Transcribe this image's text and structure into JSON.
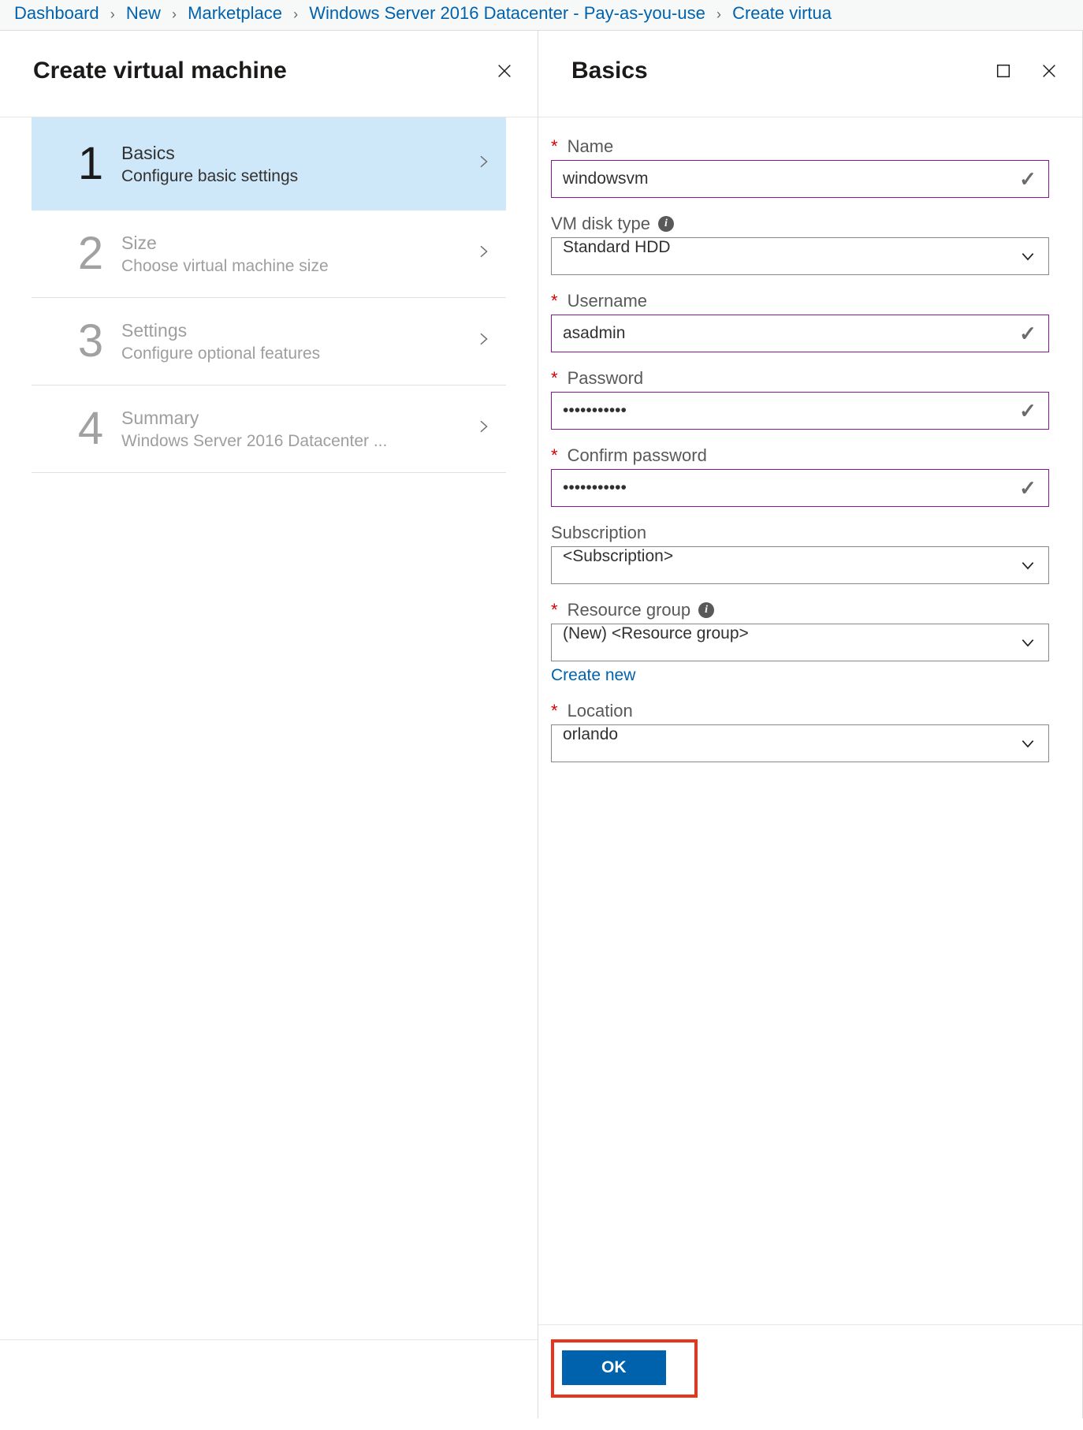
{
  "breadcrumb": {
    "items": [
      {
        "label": "Dashboard"
      },
      {
        "label": "New"
      },
      {
        "label": "Marketplace"
      },
      {
        "label": "Windows Server 2016 Datacenter - Pay-as-you-use"
      },
      {
        "label": "Create virtua"
      }
    ]
  },
  "leftBlade": {
    "title": "Create virtual machine",
    "steps": [
      {
        "num": "1",
        "title": "Basics",
        "sub": "Configure basic settings"
      },
      {
        "num": "2",
        "title": "Size",
        "sub": "Choose virtual machine size"
      },
      {
        "num": "3",
        "title": "Settings",
        "sub": "Configure optional features"
      },
      {
        "num": "4",
        "title": "Summary",
        "sub": "Windows Server 2016 Datacenter ..."
      }
    ]
  },
  "rightBlade": {
    "title": "Basics",
    "okLabel": "OK"
  },
  "form": {
    "name": {
      "label": "Name",
      "value": "windowsvm",
      "required": true
    },
    "diskType": {
      "label": "VM disk type",
      "value": "Standard HDD"
    },
    "username": {
      "label": "Username",
      "value": "asadmin",
      "required": true
    },
    "password": {
      "label": "Password",
      "value": "•••••••••••",
      "required": true
    },
    "confirmPassword": {
      "label": "Confirm password",
      "value": "•••••••••••",
      "required": true
    },
    "subscription": {
      "label": "Subscription",
      "value": "<Subscription>"
    },
    "resourceGroup": {
      "label": "Resource group",
      "value": "(New)  <Resource group>",
      "required": true,
      "createNew": "Create new"
    },
    "location": {
      "label": "Location",
      "value": "orlando",
      "required": true
    }
  },
  "icons": {
    "close": "close-icon",
    "restore": "restore-window-icon",
    "chevronRight": "chevron-right-icon",
    "chevronDown": "chevron-down-icon",
    "check": "check-icon",
    "info": "info-icon"
  }
}
